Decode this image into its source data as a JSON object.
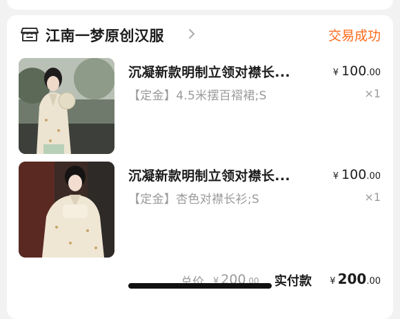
{
  "shop": {
    "name": "江南一梦原创汉服",
    "status": "交易成功",
    "icons": {
      "shop": "store-icon",
      "chevron": "chevron-right-icon"
    }
  },
  "items": [
    {
      "title": "沉凝新款明制立领对襟长...",
      "sku": "【定金】4.5米摆百褶裙;S",
      "currency": "¥",
      "price_int": "100",
      "price_dec": ".00",
      "qty": "×1",
      "image": "product-photo-woman-hanfu-garden"
    },
    {
      "title": "沉凝新款明制立领对襟长...",
      "sku": "【定金】杏色对襟长衫;S",
      "currency": "¥",
      "price_int": "100",
      "price_dec": ".00",
      "qty": "×1",
      "image": "product-photo-woman-hanfu-portrait"
    }
  ],
  "summary": {
    "total_label": "总价",
    "total_currency": "¥",
    "total_int": "200",
    "total_dec": ".00",
    "paid_label": "实付款",
    "paid_currency": "¥",
    "paid_int": "200",
    "paid_dec": ".00"
  },
  "colors": {
    "status": "#ff6a1a",
    "background": "#f2f2f2",
    "card": "#ffffff",
    "muted": "#9a9a9a"
  }
}
